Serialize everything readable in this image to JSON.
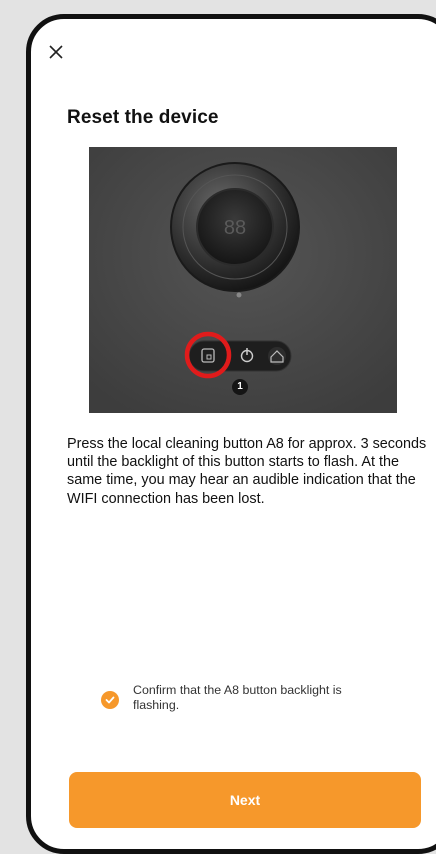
{
  "header": {
    "close_icon": "close-icon",
    "title": "Reset the device"
  },
  "image": {
    "marker_label": "1"
  },
  "instructions": "Press the local cleaning button A8 for approx. 3 seconds until the backlight of this button starts to flash. At the same time, you may hear an audible indication that the WIFI connection has been lost.",
  "confirm": {
    "checked": true,
    "text": "Confirm that the A8 button backlight is flashing."
  },
  "next_button": "Next",
  "colors": {
    "accent": "#f6982b",
    "highlight_ring": "#e01b1b",
    "image_background": "#4a4a4a"
  }
}
